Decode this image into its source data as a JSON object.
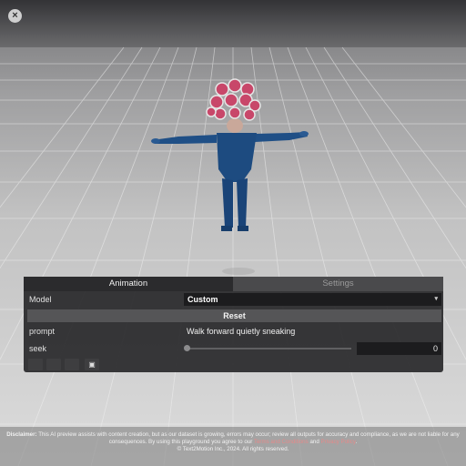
{
  "window": {
    "close_glyph": "×"
  },
  "panel": {
    "tabs": [
      {
        "label": "Animation",
        "active": true
      },
      {
        "label": "Settings",
        "active": false
      }
    ],
    "model": {
      "label": "Model",
      "value": "Custom",
      "arrow": "▾"
    },
    "reset_label": "Reset",
    "prompt": {
      "label": "prompt",
      "value": "Walk forward quietly sneaking"
    },
    "seek": {
      "label": "seek",
      "value": "0",
      "position": 0
    },
    "controls": [
      {
        "icon": "blank-icon",
        "glyph": ""
      },
      {
        "icon": "blank-icon",
        "glyph": ""
      },
      {
        "icon": "blank-icon",
        "glyph": ""
      },
      {
        "icon": "save-icon",
        "glyph": "▣"
      }
    ]
  },
  "footer": {
    "disclaimer_label": "Disclaimer:",
    "line1": " This AI preview assists with content creation, but as our dataset is growing, errors may occur; review all outputs for accuracy and compliance, as we are not liable for any",
    "line2_a": "consequences. By using this playground you agree to our ",
    "terms_link": "Terms and Conditions",
    "line2_b": " and ",
    "privacy_link": "Privacy Policy",
    "line2_c": ".",
    "copyright": "© Text2Motion Inc., 2024. All rights reserved."
  },
  "colors": {
    "panel_bg": "#28282a",
    "hair_pink": "#c8476a",
    "suit_blue": "#1f4f86"
  }
}
